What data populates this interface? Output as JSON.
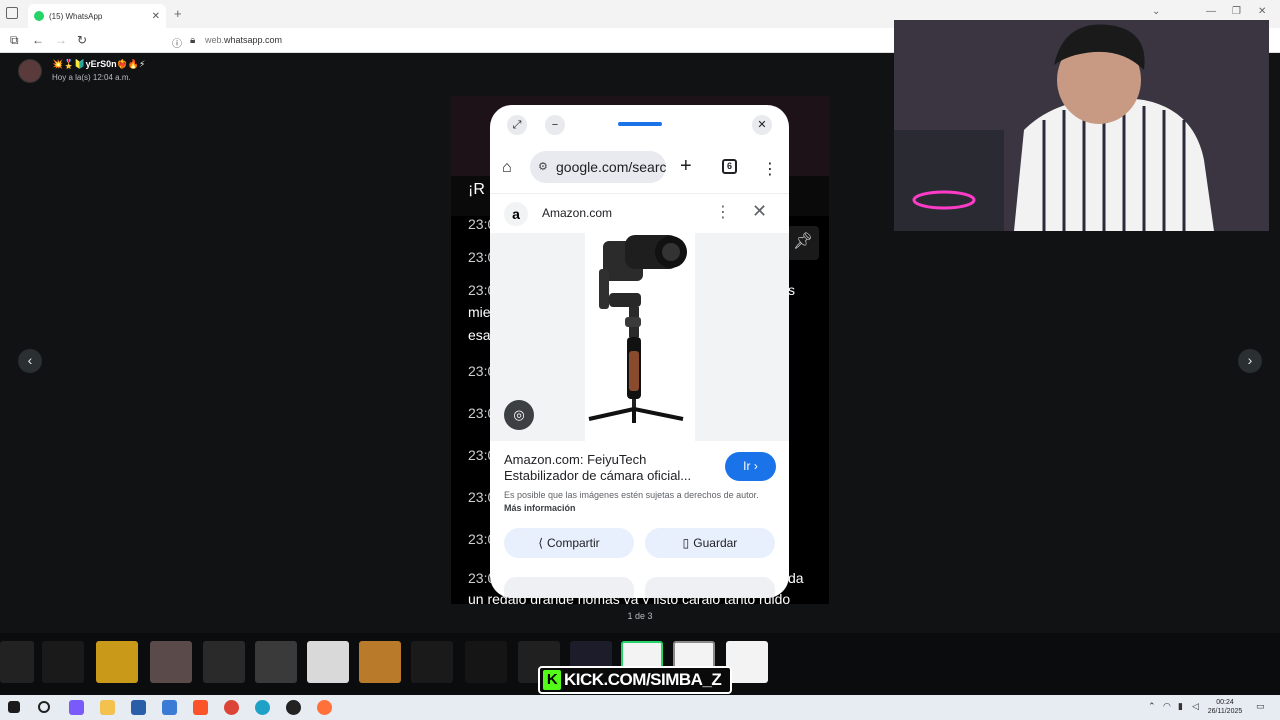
{
  "browser": {
    "tab_title": "(15) WhatsApp",
    "tab_close": "✕",
    "new_tab": "+",
    "url_domain": "whatsapp.com",
    "url_prefix": "web."
  },
  "viewer": {
    "sender_name": "💥🎖️🔰yErS0n❤️‍🔥🔥⚡",
    "timestamp": "Hoy a la(s) 12:04 a.m.",
    "page_counter": "1 de 3",
    "prev_label": "‹",
    "next_label": "›"
  },
  "media_chat": {
    "lines": [
      "23:0",
      "23:0",
      "23:0",
      "mie",
      "esa",
      "23:0",
      "23:0",
      "23:0",
      "23:0",
      "23:0",
      "23:0"
    ],
    "partial_right_1": "s",
    "partial_right_2": "da",
    "bottom_line": "un regalo grande nomas va y listo carajo tanto ruido",
    "top_partial": "¡R"
  },
  "phone": {
    "url": "google.com/search",
    "tab_count": "6",
    "source_name": "Amazon.com",
    "source_logo": "a",
    "product_title": "Amazon.com: FeiyuTech Estabilizador de cámara oficial...",
    "go_button": "Ir ›",
    "rights_text": "Es posible que las imágenes estén sujetas a derechos de autor.",
    "more_info": "Más información",
    "share_button": "Compartir",
    "save_button": "Guardar"
  },
  "overlay": {
    "kick_text": "KICK.COM/SIMBA_Z",
    "kick_logo": "K"
  },
  "taskbar": {
    "time": "00:24",
    "date": "26/11/2025"
  },
  "colors": {
    "whatsapp_green": "#25d366",
    "google_blue": "#1a73e8",
    "kick_green": "#53fc18"
  }
}
